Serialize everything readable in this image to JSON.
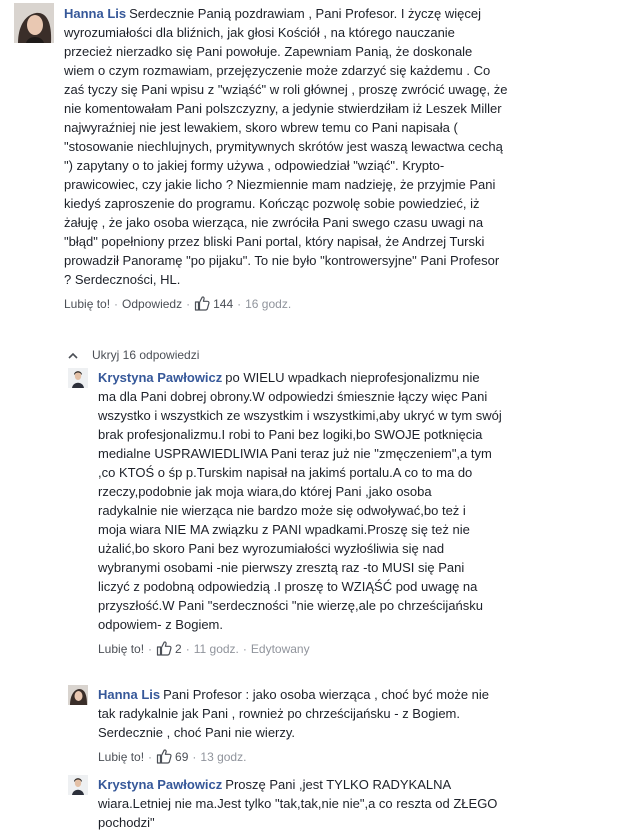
{
  "labels": {
    "like": "Lubię to!",
    "reply": "Odpowiedz",
    "hide_replies": "Ukryj 16 odpowiedzi"
  },
  "colors": {
    "author_link": "#365899",
    "meta_text": "#90949c",
    "like_icon": "#4b4f56"
  },
  "icons": {
    "like": "thumbs-up-icon",
    "collapse": "chevron-up-icon"
  },
  "comments": [
    {
      "author": "Hanna Lis",
      "text": "Serdecznie Panią pozdrawiam , Pani Profesor. I życzę więcej\nwyrozumiałości dla bliźnich, jak głosi Kościół , na którego nauczanie\nprzecież nierzadko się Pani powołuje. Zapewniam Panią, że doskonale\nwiem o czym rozmawiam, przejęzyczenie może zdarzyć się każdemu . Co\nzaś tyczy się Pani wpisu z \"wziąść\" w roli głównej , proszę zwrócić uwagę, że\nnie komentowałam Pani polszczyzny, a jedynie stwierdziłam iż Leszek Miller\nnajwyraźniej nie jest lewakiem, skoro wbrew temu co Pani napisała (\n\"stosowanie niechlujnych, prymitywnych skrótów jest waszą lewactwa cechą\n\") zapytany o to jakiej formy używa , odpowiedział \"wziąć\". Krypto-\nprawicowiec, czy jakie licho ? Niezmiennie mam nadzieję, że przyjmie Pani\nkiedyś zaproszenie do programu. Kończąc pozwolę sobie powiedzieć, iż\nżałuję , że jako osoba wierząca, nie zwróciła Pani swego czasu uwagi na\n\"błąd\" popełniony przez bliski Pani portal, który napisał, że Andrzej Turski\nprowadził Panoramę \"po pijaku\". To nie było \"kontrowersyjne\" Pani Profesor\n? Serdeczności, HL.",
      "likes": "144",
      "time": "16 godz."
    }
  ],
  "replies": [
    {
      "author": "Krystyna Pawłowicz",
      "text": "po WIELU wpadkach nieprofesjonalizmu nie\nma dla Pani dobrej obrony.W odpowiedzi śmiesznie łączy więc Pani\nwszystko i wszystkich ze wszystkim i wszystkimi,aby ukryć w tym swój\nbrak profesjonalizmu.I robi to Pani bez logiki,bo SWOJE potknięcia\nmedialne USPRAWIEDLIWIA Pani teraz już nie \"zmęczeniem\",a tym\n,co KTOŚ o śp p.Turskim napisał na jakimś portalu.A co to ma do\nrzeczy,podobnie jak moja wiara,do której Pani ,jako osoba\nradykalnie nie wierząca nie bardzo może się odwoływać,bo też i\nmoja wiara NIE MA związku z PANI wpadkami.Proszę się też nie\nużalić,bo skoro Pani bez wyrozumiałości wyzłośliwia się nad\nwybranymi osobami -nie pierwszy zresztą raz -to MUSI się Pani\nliczyć z podobną odpowiedzią .I proszę to WZIĄŚĆ pod uwagę na\nprzyszłość.W Pani \"serdeczności \"nie wierzę,ale po chrześcijańsku\nodpowiem- z Bogiem.",
      "likes": "2",
      "time": "11 godz.",
      "edited": "Edytowany"
    },
    {
      "author": "Hanna Lis",
      "text": "Pani Profesor : jako osoba wierząca , choć być może nie\ntak radykalnie jak Pani , rownież po chrześcijańsku - z Bogiem.\nSerdecznie , choć Pani nie wierzy.",
      "likes": "69",
      "time": "13 godz."
    },
    {
      "author": "Krystyna Pawłowicz",
      "text": "Proszę Pani ,jest TYLKO RADYKALNA\nwiara.Letniej nie ma.Jest tylko \"tak,tak,nie nie\",a co reszta od ZŁEGO\npochodzi\"",
      "likes": "",
      "time": ""
    }
  ]
}
